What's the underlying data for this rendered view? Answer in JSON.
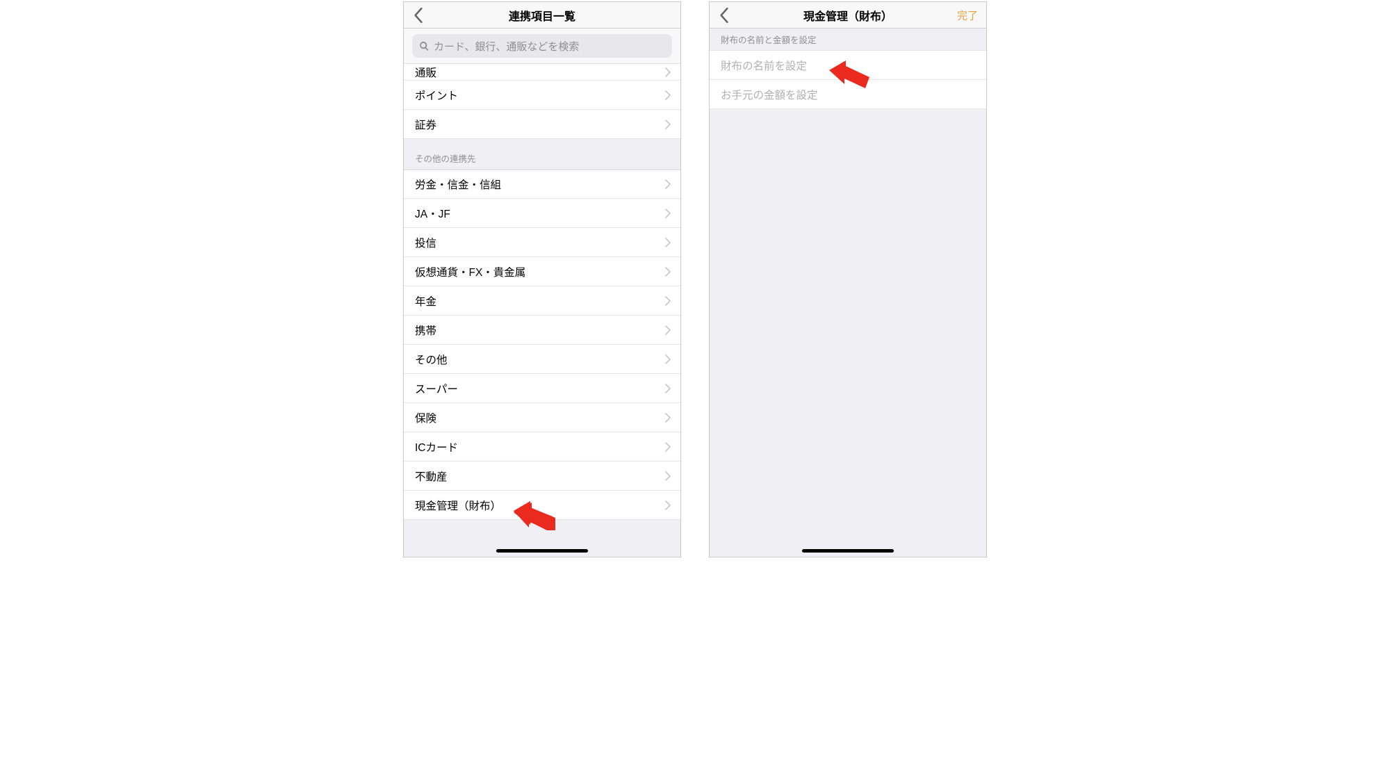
{
  "leftScreen": {
    "title": "連携項目一覧",
    "searchPlaceholder": "カード、銀行、通販などを検索",
    "topItems": [
      {
        "label": "通販"
      },
      {
        "label": "ポイント"
      },
      {
        "label": "証券"
      }
    ],
    "otherSectionHeader": "その他の連携先",
    "otherItems": [
      {
        "label": "労金・信金・信組"
      },
      {
        "label": "JA・JF"
      },
      {
        "label": "投信"
      },
      {
        "label": "仮想通貨・FX・貴金属"
      },
      {
        "label": "年金"
      },
      {
        "label": "携帯"
      },
      {
        "label": "その他"
      },
      {
        "label": "スーパー"
      },
      {
        "label": "保険"
      },
      {
        "label": "ICカード"
      },
      {
        "label": "不動産"
      },
      {
        "label": "現金管理（財布）"
      }
    ]
  },
  "rightScreen": {
    "title": "現金管理（財布）",
    "doneLabel": "完了",
    "sectionHeader": "財布の名前と金額を設定",
    "fields": [
      {
        "placeholder": "財布の名前を設定"
      },
      {
        "placeholder": "お手元の金額を設定"
      }
    ]
  }
}
